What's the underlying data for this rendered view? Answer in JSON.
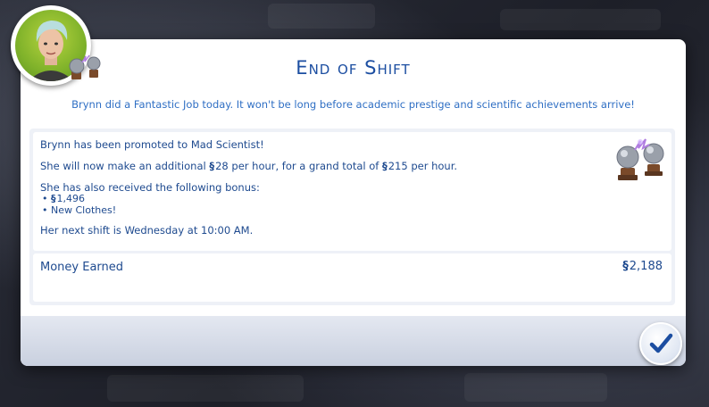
{
  "dialog": {
    "title": "End of Shift",
    "subtitle": "Brynn did a Fantastic Job today. It won't be long before academic prestige and scientific achievements arrive!"
  },
  "details": {
    "promotion": "Brynn has been promoted to Mad Scientist!",
    "pay_prefix": "She will now make an additional",
    "pay_increase": "28",
    "pay_middle": "per hour, for a grand total of",
    "pay_total": "215",
    "pay_suffix": "per hour.",
    "bonus_heading": "She has also received the following bonus:",
    "bonus_items": [
      "1,496",
      "New Clothes!"
    ],
    "next_shift": "Her next shift is Wednesday at 10:00  AM."
  },
  "money": {
    "label": "Money Earned",
    "value": "2,188"
  },
  "currency_symbol": "§",
  "icons": {
    "career": "plasma-globe-icon",
    "confirm": "checkmark-icon"
  },
  "colors": {
    "title": "#1c4ea1",
    "text": "#1e4a8f",
    "subtitle": "#2f6fc4",
    "avatar_bg": "#8fbe2c",
    "accent_purple": "#b07de0"
  }
}
